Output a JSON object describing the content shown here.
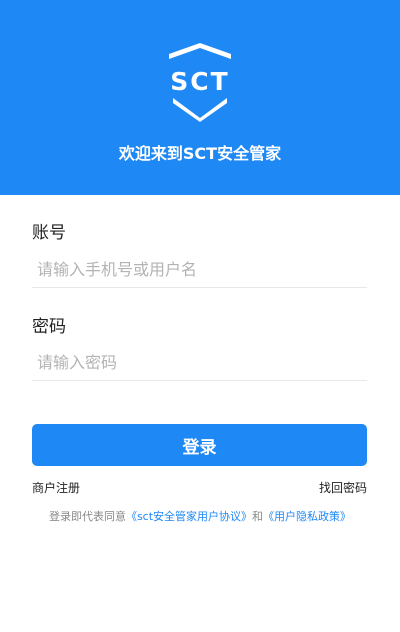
{
  "header": {
    "logo_text": "SCT",
    "welcome": "欢迎来到SCT安全管家",
    "background_color": "#1e88f5"
  },
  "form": {
    "account_label": "账号",
    "account_placeholder": "请输入手机号或用户名",
    "password_label": "密码",
    "password_placeholder": "请输入密码",
    "login_button": "登录"
  },
  "links": {
    "register": "商户注册",
    "forgot_password": "找回密码"
  },
  "agreement": {
    "prefix": "登录即代表同意",
    "user_agreement": "《sct安全管家用户协议》",
    "conjunction": "和",
    "privacy_policy": "《用户隐私政策》"
  },
  "colors": {
    "accent": "#1e88f5"
  }
}
